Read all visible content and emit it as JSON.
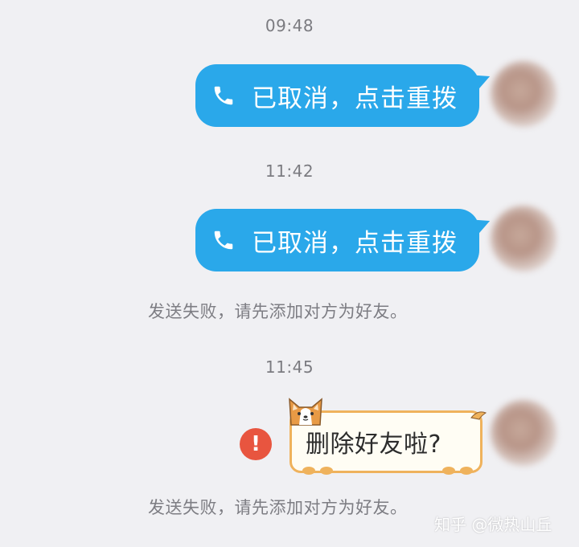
{
  "chat": {
    "messages": [
      {
        "time": "09:48",
        "call_text": "已取消，点击重拨"
      },
      {
        "time": "11:42",
        "call_text": "已取消，点击重拨",
        "notice": "发送失败，请先添加对方为好友。"
      },
      {
        "time": "11:45",
        "sticker_text": "删除好友啦?",
        "notice": "发送失败，请先添加对方为好友。"
      }
    ]
  },
  "watermark": "知乎 @微热山丘",
  "colors": {
    "background": "#f0f0f3",
    "bubble_blue": "#2aa8ea",
    "error_red": "#e8553f",
    "sticker_border": "#efb25c"
  },
  "icons": {
    "call": "phone-icon",
    "error": "exclamation-circle-icon",
    "sticker": "corgi-icon"
  }
}
